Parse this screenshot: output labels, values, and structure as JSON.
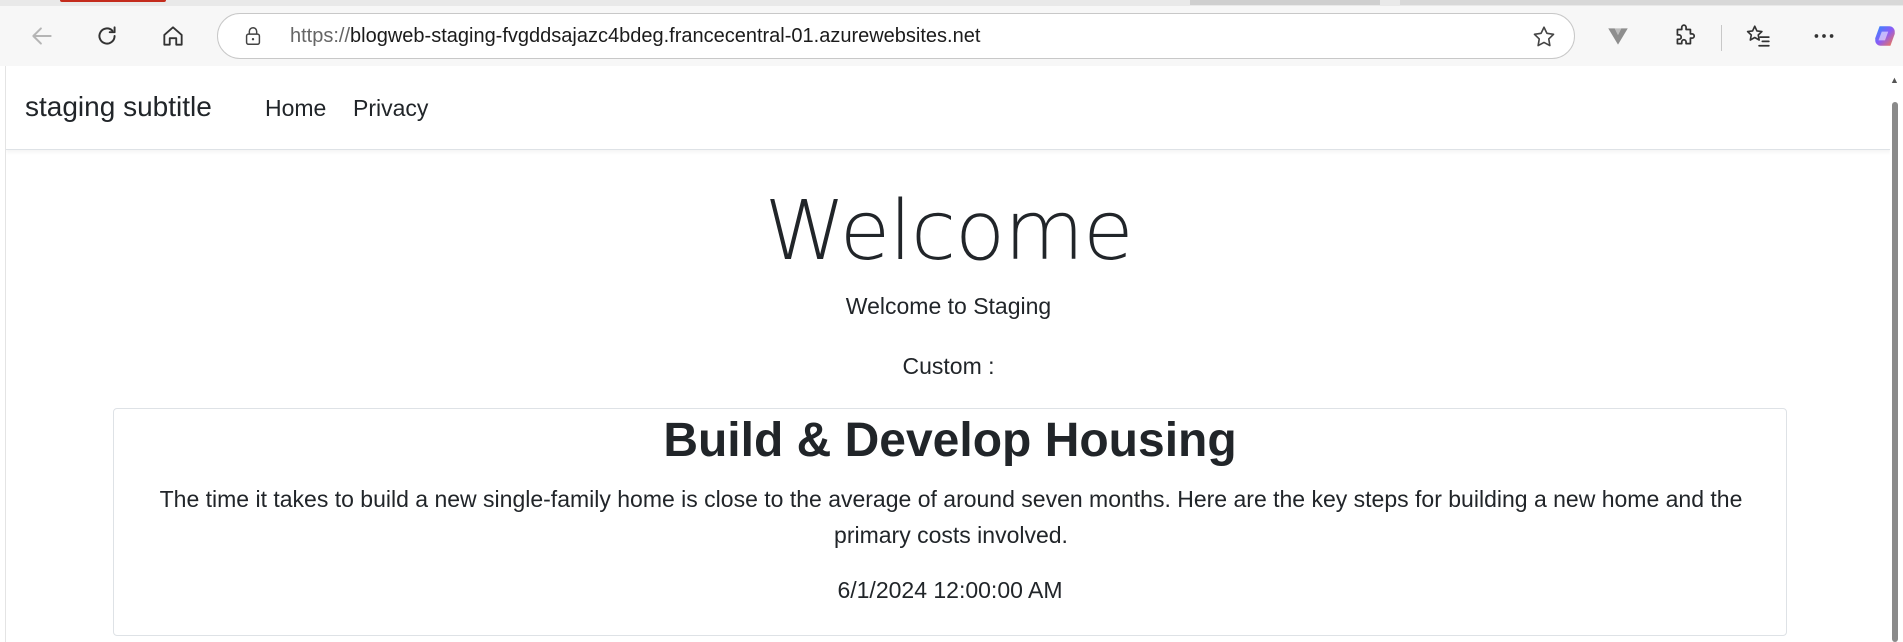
{
  "browser": {
    "address_bar": {
      "protocol": "https://",
      "host": "blogweb-staging-fvgddsajazc4bdeg.francecentral-01.azurewebsites.net"
    },
    "toolbar_icons": [
      "back-icon",
      "refresh-icon",
      "home-icon",
      "lock-icon",
      "favorite-star-icon",
      "extension-v-icon",
      "extensions-puzzle-icon",
      "favorites-icon",
      "more-icon",
      "copilot-icon"
    ],
    "colors": {
      "active_tab_indicator": "#c42b1c",
      "copilot_gradient": [
        "#2b8cff",
        "#8b5cf6",
        "#ff7a3d"
      ]
    }
  },
  "site": {
    "navbar": {
      "brand": "staging subtitle",
      "links": [
        "Home",
        "Privacy"
      ]
    },
    "hero": {
      "heading": "Welcome",
      "subheading": "Welcome to Staging",
      "custom_label": "Custom :"
    },
    "card": {
      "title": "Build & Develop Housing",
      "body": "The time it takes to build a new single-family home is close to the average of around seven months. Here are the key steps for building a new home and the primary costs involved.",
      "date": "6/1/2024 12:00:00 AM"
    }
  }
}
